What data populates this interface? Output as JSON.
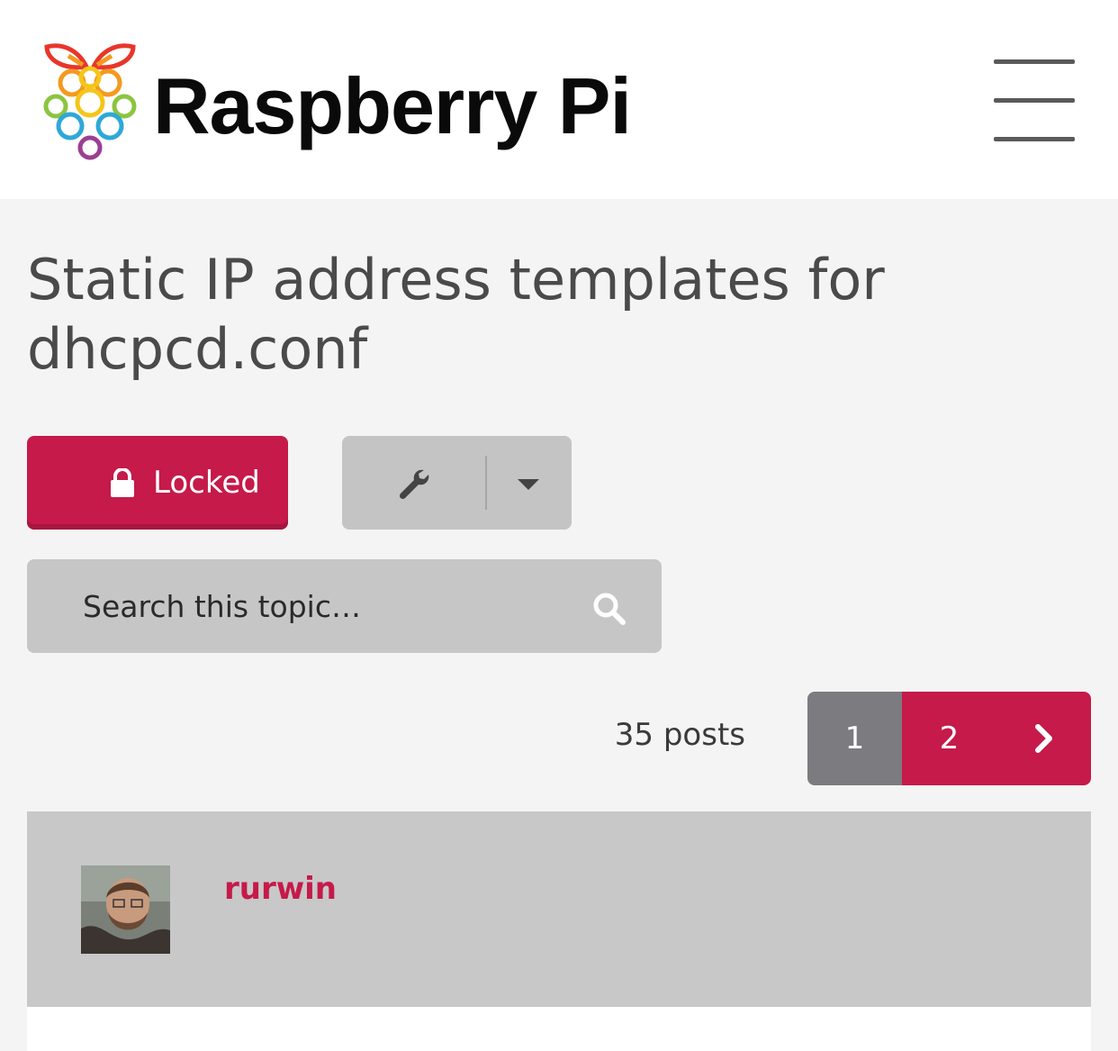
{
  "header": {
    "brand": "Raspberry Pi",
    "logo_icon": "raspberry-logo-icon",
    "menu_icon": "hamburger-menu-icon"
  },
  "topic": {
    "title": "Static IP address templates for dhcpcd.conf"
  },
  "actions": {
    "locked_label": "Locked",
    "lock_icon": "lock-icon",
    "tools_icon": "wrench-icon",
    "dropdown_icon": "caret-down-icon"
  },
  "search": {
    "placeholder": "Search this topic…",
    "icon": "search-icon"
  },
  "pagination": {
    "post_count": "35 posts",
    "pages": [
      "1",
      "2"
    ],
    "current_page": "2",
    "next_icon": "chevron-right-icon"
  },
  "post": {
    "author": "rurwin",
    "avatar_icon": "avatar"
  },
  "colors": {
    "accent": "#c51a4a",
    "page_inactive": "#7b7b80",
    "panel": "#c8c8c8",
    "background": "#f4f4f4"
  }
}
